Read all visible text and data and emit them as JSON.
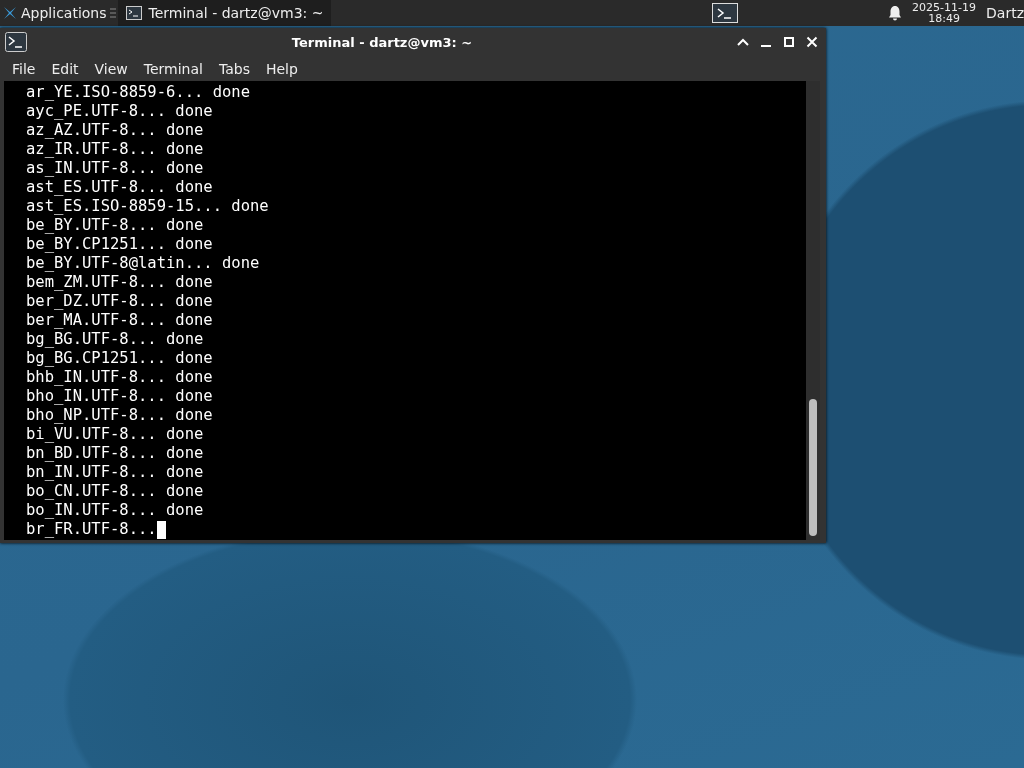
{
  "panel": {
    "applications": "Applications",
    "tasks": [
      {
        "label": "Terminal - dartz@vm3: ~",
        "selected": true
      }
    ],
    "date": "2025-11-19",
    "time": "18:49",
    "user": "Dartz"
  },
  "window": {
    "title": "Terminal - dartz@vm3: ~"
  },
  "menu": [
    "File",
    "Edit",
    "View",
    "Terminal",
    "Tabs",
    "Help"
  ],
  "terminal": {
    "lines": [
      "ar_YE.ISO-8859-6... done",
      "ayc_PE.UTF-8... done",
      "az_AZ.UTF-8... done",
      "az_IR.UTF-8... done",
      "as_IN.UTF-8... done",
      "ast_ES.UTF-8... done",
      "ast_ES.ISO-8859-15... done",
      "be_BY.UTF-8... done",
      "be_BY.CP1251... done",
      "be_BY.UTF-8@latin... done",
      "bem_ZM.UTF-8... done",
      "ber_DZ.UTF-8... done",
      "ber_MA.UTF-8... done",
      "bg_BG.UTF-8... done",
      "bg_BG.CP1251... done",
      "bhb_IN.UTF-8... done",
      "bho_IN.UTF-8... done",
      "bho_NP.UTF-8... done",
      "bi_VU.UTF-8... done",
      "bn_BD.UTF-8... done",
      "bn_IN.UTF-8... done",
      "bo_CN.UTF-8... done",
      "bo_IN.UTF-8... done",
      "br_FR.UTF-8..."
    ]
  }
}
